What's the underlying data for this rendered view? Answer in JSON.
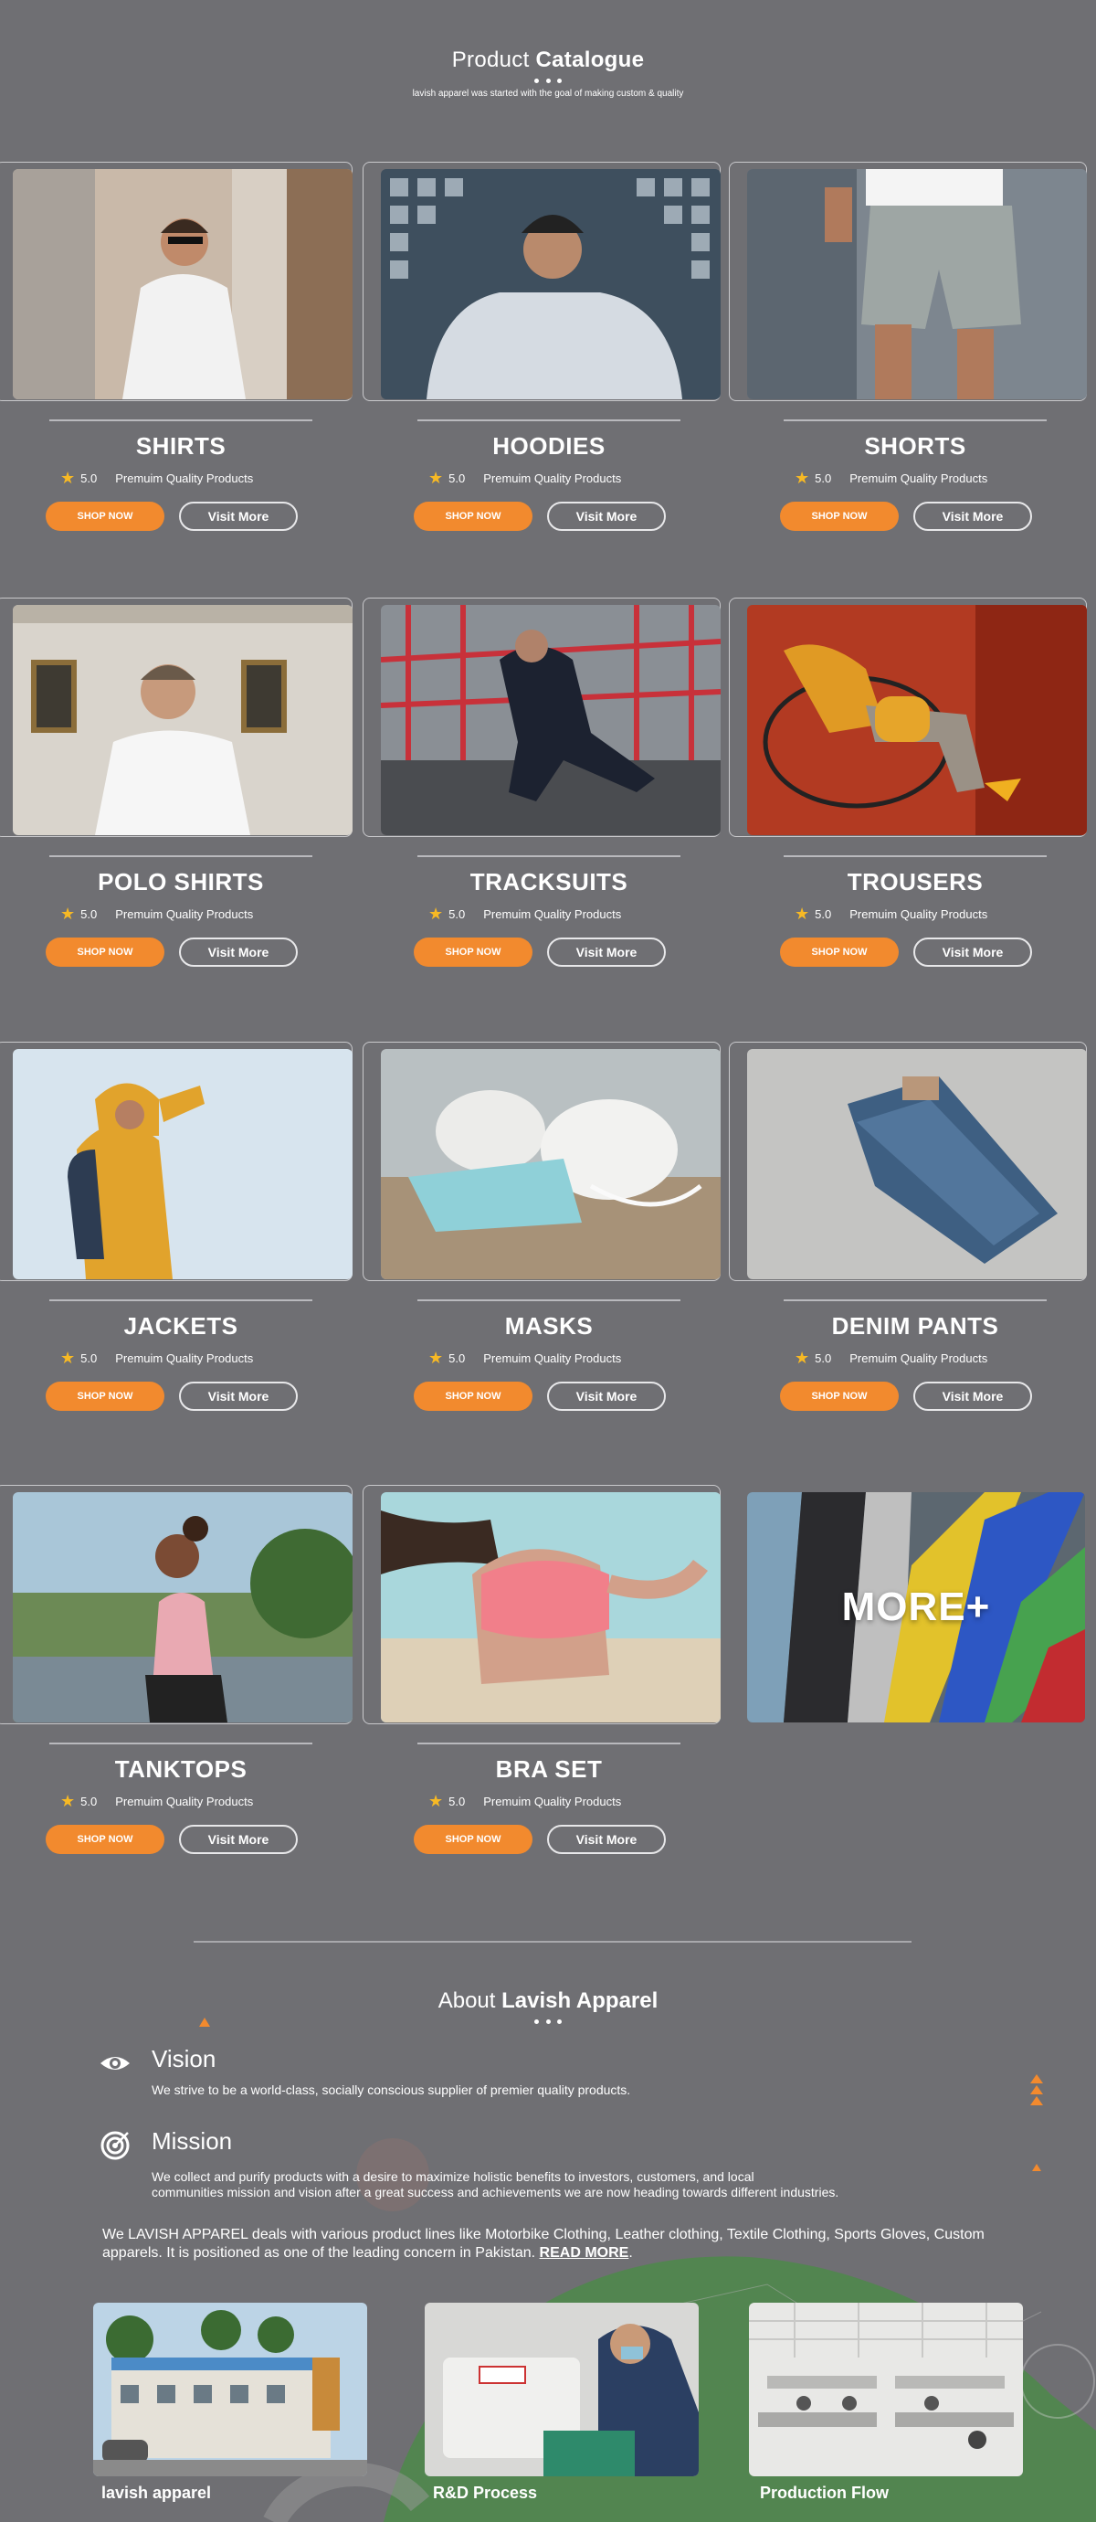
{
  "catalogue": {
    "title_light": "Product",
    "title_bold": "Catalogue",
    "subtitle": "lavish apparel was started with the goal of making custom & quality"
  },
  "products": [
    {
      "name": "SHIRTS",
      "rating": "5.0",
      "quality": "Premuim Quality Products",
      "shop": "SHOP NOW",
      "visit": "Visit More"
    },
    {
      "name": "HOODIES",
      "rating": "5.0",
      "quality": "Premuim Quality Products",
      "shop": "SHOP NOW",
      "visit": "Visit More"
    },
    {
      "name": "SHORTS",
      "rating": "5.0",
      "quality": "Premuim Quality Products",
      "shop": "SHOP NOW",
      "visit": "Visit More"
    },
    {
      "name": "POLO SHIRTS",
      "rating": "5.0",
      "quality": "Premuim Quality Products",
      "shop": "SHOP NOW",
      "visit": "Visit More"
    },
    {
      "name": "TRACKSUITS",
      "rating": "5.0",
      "quality": "Premuim Quality Products",
      "shop": "SHOP NOW",
      "visit": "Visit More"
    },
    {
      "name": "TROUSERS",
      "rating": "5.0",
      "quality": "Premuim Quality Products",
      "shop": "SHOP NOW",
      "visit": "Visit More"
    },
    {
      "name": "JACKETS",
      "rating": "5.0",
      "quality": "Premuim Quality Products",
      "shop": "SHOP NOW",
      "visit": "Visit More"
    },
    {
      "name": "MASKS",
      "rating": "5.0",
      "quality": "Premuim Quality Products",
      "shop": "SHOP NOW",
      "visit": "Visit More"
    },
    {
      "name": "DENIM PANTS",
      "rating": "5.0",
      "quality": "Premuim Quality Products",
      "shop": "SHOP NOW",
      "visit": "Visit More"
    },
    {
      "name": "TANKTOPS",
      "rating": "5.0",
      "quality": "Premuim Quality Products",
      "shop": "SHOP NOW",
      "visit": "Visit More"
    },
    {
      "name": "BRA SET",
      "rating": "5.0",
      "quality": "Premuim Quality Products",
      "shop": "SHOP NOW",
      "visit": "Visit More"
    }
  ],
  "more": {
    "label": "MORE+"
  },
  "about": {
    "title_light": "About",
    "title_bold": "Lavish Apparel",
    "vision_title": "Vision",
    "vision_text": "We strive to be a world-class, socially conscious supplier of premier quality products.",
    "mission_title": "Mission",
    "mission_text_1": "We collect and purify products with a desire to maximize holistic benefits to investors, customers, and local",
    "mission_text_2": "communities mission and vision after a great success and achievements we are now heading towards different industries.",
    "paragraph": "We LAVISH APPAREL deals with various product lines like Motorbike Clothing, Leather clothing, Textile Clothing, Sports Gloves, Custom apparels. It is positioned as one of the leading concern in Pakistan.",
    "read_more": "READ MORE"
  },
  "gallery": [
    {
      "label": "lavish apparel"
    },
    {
      "label": "R&D Process"
    },
    {
      "label": "Production Flow"
    }
  ],
  "colors": {
    "accent": "#f28a2e",
    "background": "#6f6f73",
    "star": "#f7b924",
    "green_deco": "#4e8a4a"
  }
}
